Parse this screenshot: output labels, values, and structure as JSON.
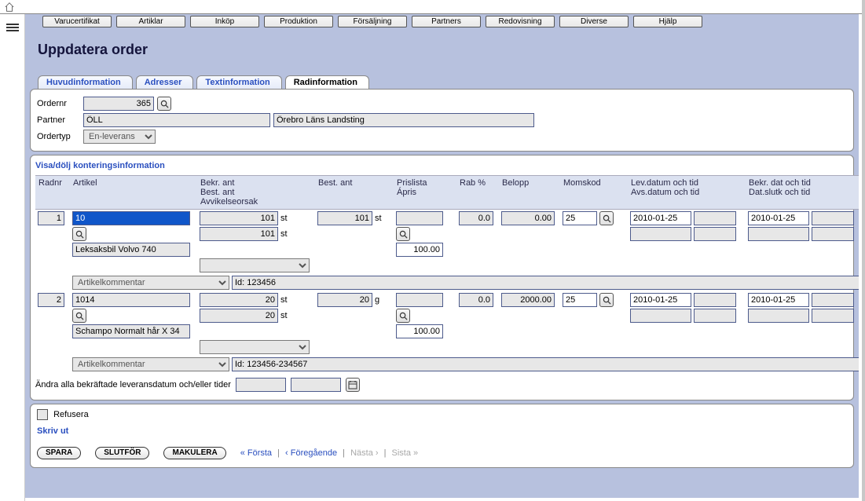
{
  "menu": [
    "Varucertifikat",
    "Artiklar",
    "Inköp",
    "Produktion",
    "Försäljning",
    "Partners",
    "Redovisning",
    "Diverse",
    "Hjälp"
  ],
  "pageTitle": "Uppdatera order",
  "tabs": [
    "Huvudinformation",
    "Adresser",
    "Textinformation",
    "Radinformation"
  ],
  "activeTab": 3,
  "header": {
    "ordernr_label": "Ordernr",
    "ordernr_value": "365",
    "partner_label": "Partner",
    "partner_code": "ÖLL",
    "partner_name": "Örebro Läns Landsting",
    "ordertyp_label": "Ordertyp",
    "ordertyp_value": "En-leverans"
  },
  "sectionToggle": "Visa/dölj konteringsinformation",
  "columns": {
    "radnr": "Radnr",
    "artikel": "Artikel",
    "bekr": "Bekr. ant\nBest. ant\nAvvikelseorsak",
    "best": "Best. ant",
    "pris": "Prislista\nÁpris",
    "rab": "Rab %",
    "belopp": "Belopp",
    "moms": "Momskod",
    "lev": "Lev.datum och tid\nAvs.datum och tid",
    "bekrdat": "Bekr. dat och tid\nDat.slutk och tid"
  },
  "rows": [
    {
      "nr": "1",
      "artikel_code": "10",
      "artikel_desc": "Leksaksbil Volvo 740",
      "bekr_ant": "101",
      "best_ant_local": "101",
      "best_ant": "101",
      "unit": "st",
      "apris": "100.00",
      "rab": "0.0",
      "belopp": "0.00",
      "moms": "25",
      "levdatum": "2010-01-25",
      "bekrdatum": "2010-01-25",
      "comment_placeholder": "Artikelkommentar",
      "comment_value": "Id: 123456"
    },
    {
      "nr": "2",
      "artikel_code": "1014",
      "artikel_desc": "Schampo Normalt hår X 34",
      "bekr_ant": "20",
      "best_ant_local": "20",
      "best_ant": "20",
      "unit": "g",
      "apris": "100.00",
      "rab": "0.0",
      "belopp": "2000.00",
      "moms": "25",
      "levdatum": "2010-01-25",
      "bekrdatum": "2010-01-25",
      "comment_placeholder": "Artikelkommentar",
      "comment_value": "Id: 123456-234567"
    }
  ],
  "changeAll_label": "Ändra alla bekräftade leveransdatum och/eller tider",
  "refusera_label": "Refusera",
  "print_label": "Skriv ut",
  "actions": [
    "SPARA",
    "SLUTFÖR",
    "MAKULERA"
  ],
  "pager": {
    "first": "« Första",
    "prev": "‹ Föregående",
    "next": "Nästa ›",
    "last": "Sista »"
  },
  "unit_st": "st"
}
